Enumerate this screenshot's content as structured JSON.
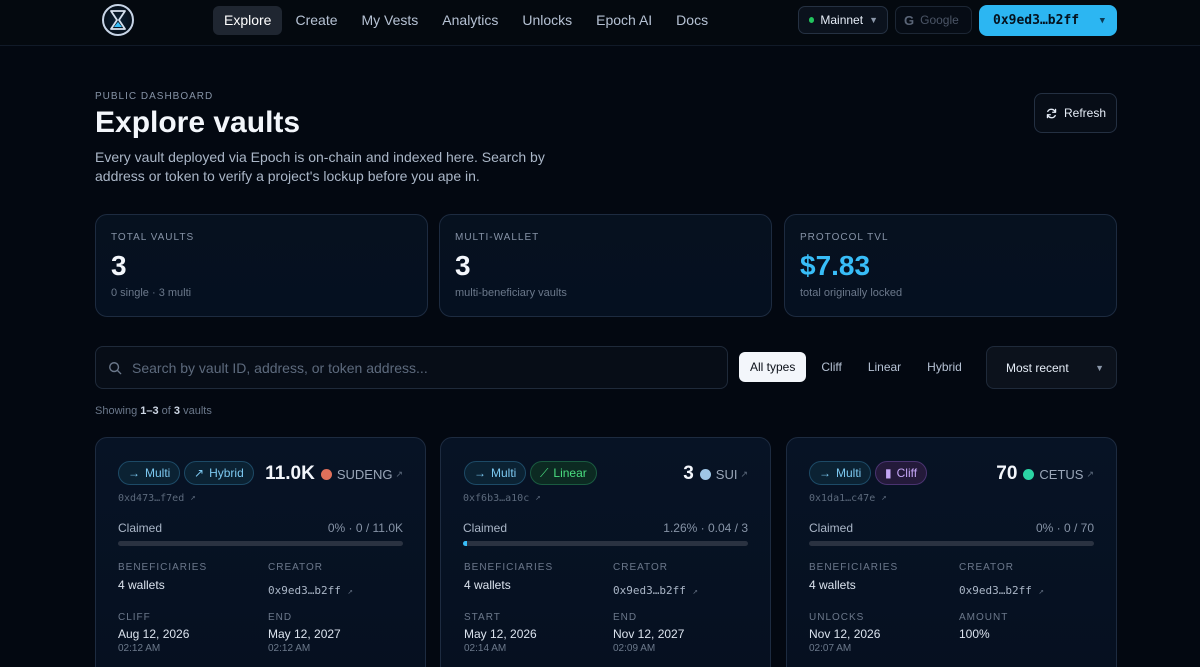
{
  "nav": {
    "links": [
      "Explore",
      "Create",
      "My Vests",
      "Analytics",
      "Unlocks",
      "Epoch AI",
      "Docs"
    ],
    "network": "Mainnet",
    "google": "Google",
    "wallet": "0x9ed3…b2ff"
  },
  "header": {
    "eyebrow": "PUBLIC DASHBOARD",
    "title": "Explore vaults",
    "subtitle": "Every vault deployed via Epoch is on-chain and indexed here. Search by address or token to verify a project's lockup before you ape in.",
    "refresh": "Refresh"
  },
  "stats": [
    {
      "label": "TOTAL VAULTS",
      "value": "3",
      "sub": "0 single · 3 multi"
    },
    {
      "label": "MULTI-WALLET",
      "value": "3",
      "sub": "multi-beneficiary vaults"
    },
    {
      "label": "PROTOCOL TVL",
      "value": "$7.83",
      "sub": "total originally locked"
    }
  ],
  "search": {
    "placeholder": "Search by vault ID, address, or token address..."
  },
  "filters": [
    "All types",
    "Cliff",
    "Linear",
    "Hybrid"
  ],
  "sort": "Most recent",
  "showing": {
    "prefix": "Showing ",
    "range": "1–3",
    "mid": " of ",
    "total": "3",
    "suffix": " vaults"
  },
  "cards": [
    {
      "badge1": "Multi",
      "badge2": "Hybrid",
      "amount": "11.0K",
      "token": "SUDENG",
      "token_color": "#e0705a",
      "vault_id": "0xd473…f7ed",
      "claimed_label": "Claimed",
      "claimed_value": "0% · 0 / 11.0K",
      "progress": 0,
      "k1": "BENEFICIARIES",
      "v1": "4 wallets",
      "k2": "CREATOR",
      "v2": "0x9ed3…b2ff",
      "k3": "CLIFF",
      "v3": "Aug 12, 2026",
      "t3": "02:12 AM",
      "k4": "END",
      "v4": "May 12, 2027",
      "t4": "02:12 AM"
    },
    {
      "badge1": "Multi",
      "badge2": "Linear",
      "amount": "3",
      "token": "SUI",
      "token_color": "#9fc6e6",
      "vault_id": "0xf6b3…a10c",
      "claimed_label": "Claimed",
      "claimed_value": "1.26% · 0.04 / 3",
      "progress": 0.0126,
      "k1": "BENEFICIARIES",
      "v1": "4 wallets",
      "k2": "CREATOR",
      "v2": "0x9ed3…b2ff",
      "k3": "START",
      "v3": "May 12, 2026",
      "t3": "02:14 AM",
      "k4": "END",
      "v4": "Nov 12, 2027",
      "t4": "02:09 AM"
    },
    {
      "badge1": "Multi",
      "badge2": "Cliff",
      "amount": "70",
      "token": "CETUS",
      "token_color": "#2bd4a4",
      "vault_id": "0x1da1…c47e",
      "claimed_label": "Claimed",
      "claimed_value": "0% · 0 / 70",
      "progress": 0,
      "k1": "BENEFICIARIES",
      "v1": "4 wallets",
      "k2": "CREATOR",
      "v2": "0x9ed3…b2ff",
      "k3": "UNLOCKS",
      "v3": "Nov 12, 2026",
      "t3": "02:07 AM",
      "k4": "AMOUNT",
      "v4": "100%",
      "t4": ""
    }
  ],
  "colors": {
    "accent": "#38bdf8",
    "wallet_bg": "#2cb6f2",
    "network_status": "#22c55e"
  }
}
